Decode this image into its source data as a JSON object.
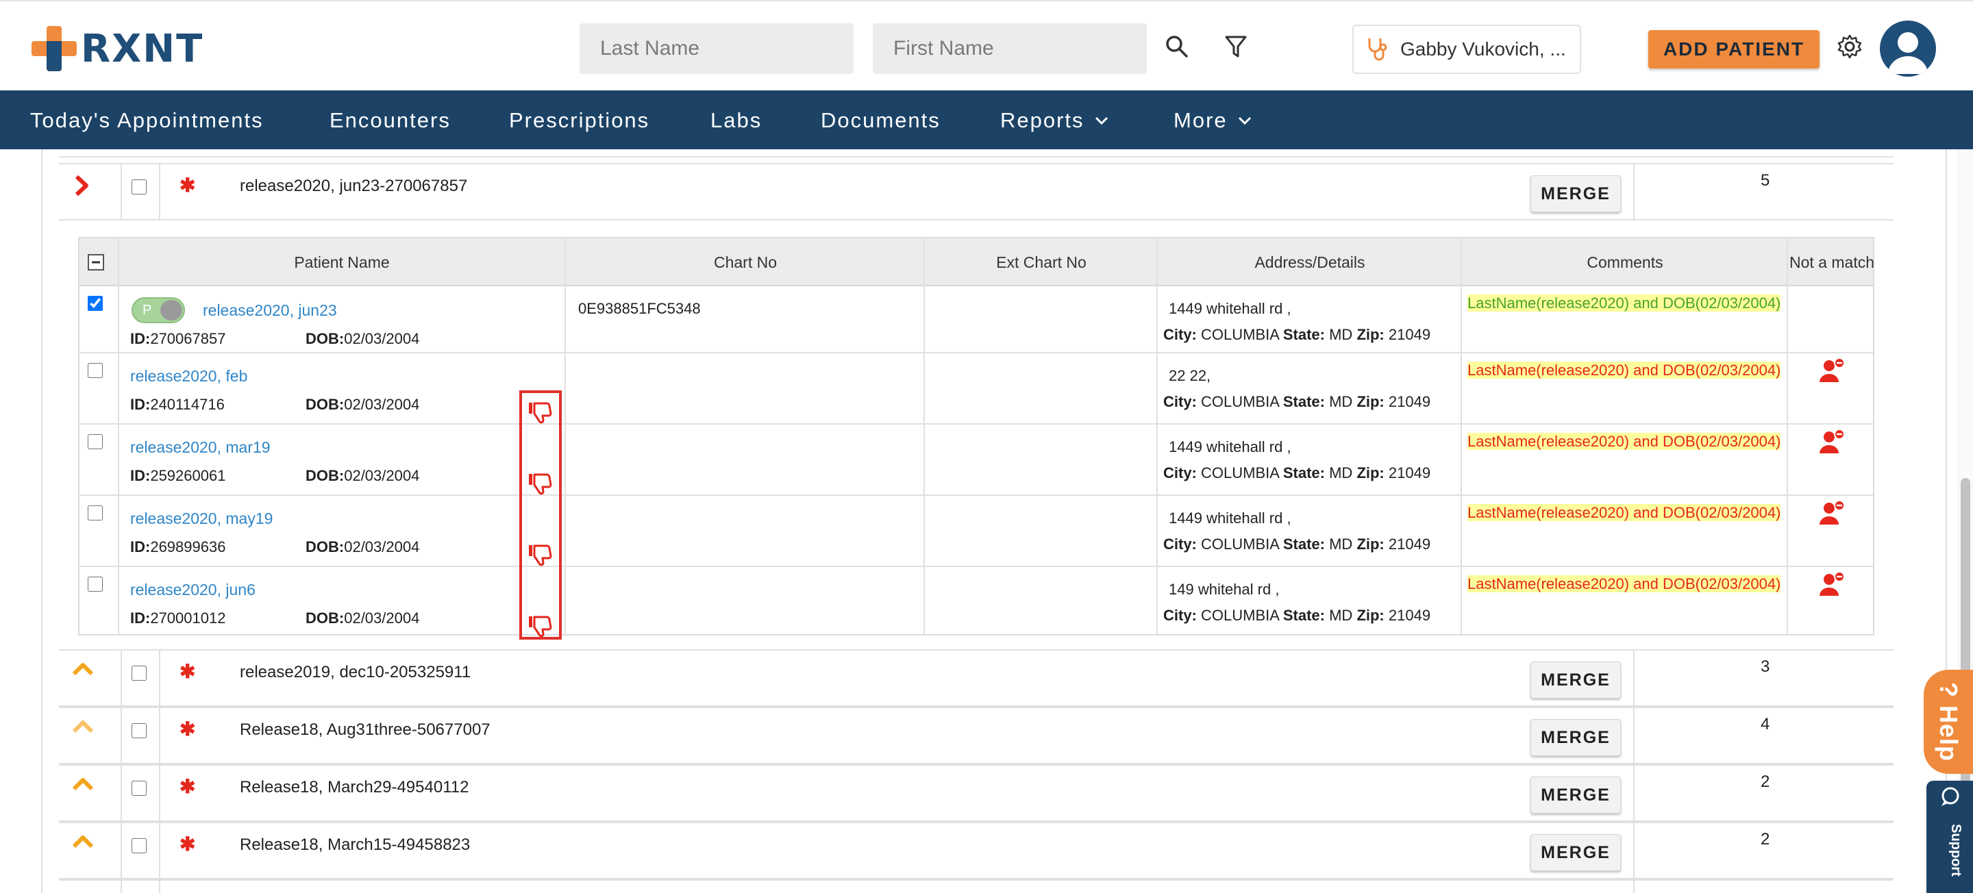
{
  "app": {
    "logo_text": "RXNT",
    "brand_color": "#1f4e79",
    "accent_color": "#f08a3c"
  },
  "header": {
    "last_name_placeholder": "Last Name",
    "first_name_placeholder": "First Name",
    "provider_label": "Gabby Vukovich, ...",
    "add_patient_label": "ADD PATIENT",
    "icons": [
      "search-icon",
      "filter-icon",
      "stethoscope-icon",
      "gear-icon",
      "user-avatar-icon"
    ]
  },
  "nav": {
    "items": [
      {
        "label": "Today's Appointments"
      },
      {
        "label": "Encounters"
      },
      {
        "label": "Prescriptions"
      },
      {
        "label": "Labs"
      },
      {
        "label": "Documents"
      },
      {
        "label": "Reports"
      },
      {
        "label": "More"
      }
    ]
  },
  "groups": [
    {
      "name": "release2020, jun23-270067857",
      "merge_label": "MERGE",
      "count": "5",
      "expanded": true,
      "arrow_color": "#e5271d"
    },
    {
      "name": "release2019, dec10-205325911",
      "merge_label": "MERGE",
      "count": "3",
      "expanded": false,
      "arrow_color": "#f4a51c"
    },
    {
      "name": "Release18, Aug31three-50677007",
      "merge_label": "MERGE",
      "count": "4",
      "expanded": false,
      "arrow_color": "#f4a51c"
    },
    {
      "name": "Release18, March29-49540112",
      "merge_label": "MERGE",
      "count": "2",
      "expanded": false,
      "arrow_color": "#f4a51c"
    },
    {
      "name": "Release18, March15-49458823",
      "merge_label": "MERGE",
      "count": "2",
      "expanded": false,
      "arrow_color": "#f4a51c"
    }
  ],
  "inner_table": {
    "headers": [
      "Patient Name",
      "Chart No",
      "Ext Chart No",
      "Address/Details",
      "Comments",
      "Not a match"
    ],
    "id_label": "ID:",
    "dob_label": "DOB:",
    "city_label": "City:",
    "state_label": "State:",
    "zip_label": "Zip:",
    "primary_toggle_label": "P",
    "rows": [
      {
        "name": "release2020, jun23",
        "id": "270067857",
        "dob": "02/03/2004",
        "chart_no": "0E938851FC5348",
        "ext_chart_no": "",
        "street": "1449 whitehall rd ,",
        "city": "COLUMBIA",
        "state": "MD",
        "zip": "21049",
        "comment": "LastName(release2020) and DOB(02/03/2004)",
        "checked": true,
        "primary": true
      },
      {
        "name": "release2020, feb",
        "id": "240114716",
        "dob": "02/03/2004",
        "chart_no": "",
        "ext_chart_no": "",
        "street": "22 22,",
        "city": "COLUMBIA",
        "state": "MD",
        "zip": "21049",
        "comment": "LastName(release2020) and DOB(02/03/2004)",
        "checked": false,
        "primary": false
      },
      {
        "name": "release2020, mar19",
        "id": "259260061",
        "dob": "02/03/2004",
        "chart_no": "",
        "ext_chart_no": "",
        "street": "1449 whitehall rd ,",
        "city": "COLUMBIA",
        "state": "MD",
        "zip": "21049",
        "comment": "LastName(release2020) and DOB(02/03/2004)",
        "checked": false,
        "primary": false
      },
      {
        "name": "release2020, may19",
        "id": "269899636",
        "dob": "02/03/2004",
        "chart_no": "",
        "ext_chart_no": "",
        "street": "1449 whitehall rd ,",
        "city": "COLUMBIA",
        "state": "MD",
        "zip": "21049",
        "comment": "LastName(release2020) and DOB(02/03/2004)",
        "checked": false,
        "primary": false
      },
      {
        "name": "release2020, jun6",
        "id": "270001012",
        "dob": "02/03/2004",
        "chart_no": "",
        "ext_chart_no": "",
        "street": "149 whitehal rd ,",
        "city": "COLUMBIA",
        "state": "MD",
        "zip": "21049",
        "comment": "LastName(release2020) and DOB(02/03/2004)",
        "checked": false,
        "primary": false
      }
    ]
  },
  "widgets": {
    "help_label": "Help",
    "support_label": "Support"
  }
}
